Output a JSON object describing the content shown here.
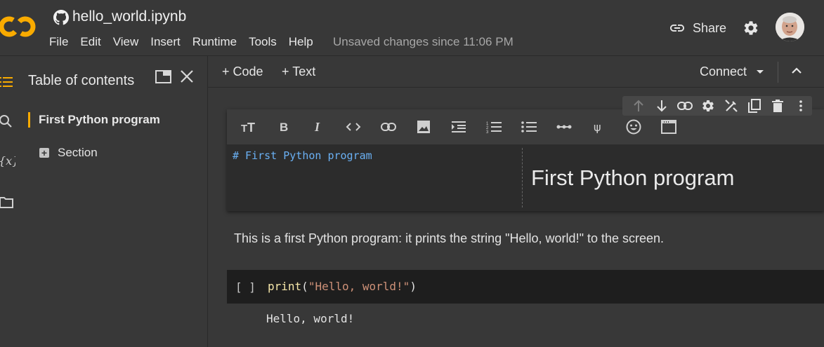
{
  "app": {
    "logo_text": "CO",
    "title": "hello_world.ipynb",
    "menu": [
      "File",
      "Edit",
      "View",
      "Insert",
      "Runtime",
      "Tools",
      "Help"
    ],
    "unsaved": "Unsaved changes since 11:06 PM",
    "share_label": "Share"
  },
  "sidebar": {
    "title": "Table of contents",
    "items": [
      {
        "label": "First Python program"
      },
      {
        "label": "Section"
      }
    ]
  },
  "toolbar": {
    "add_code": "+ Code",
    "add_text": "+ Text",
    "connect": "Connect"
  },
  "text_cell": {
    "source": "# First Python program",
    "preview": "First Python program"
  },
  "paragraph": "This is a first Python program: it prints the string \"Hello, world!\" to the screen.",
  "code_cell": {
    "bracket": "[ ]",
    "fn": "print",
    "open": "(",
    "string": "\"Hello, world!\"",
    "close": ")",
    "output": "Hello, world!"
  },
  "colors": {
    "accent": "#f9ab00",
    "logo_orange": "#f9ab00",
    "markdown_source": "#6ab0f3",
    "string": "#ce9178"
  }
}
